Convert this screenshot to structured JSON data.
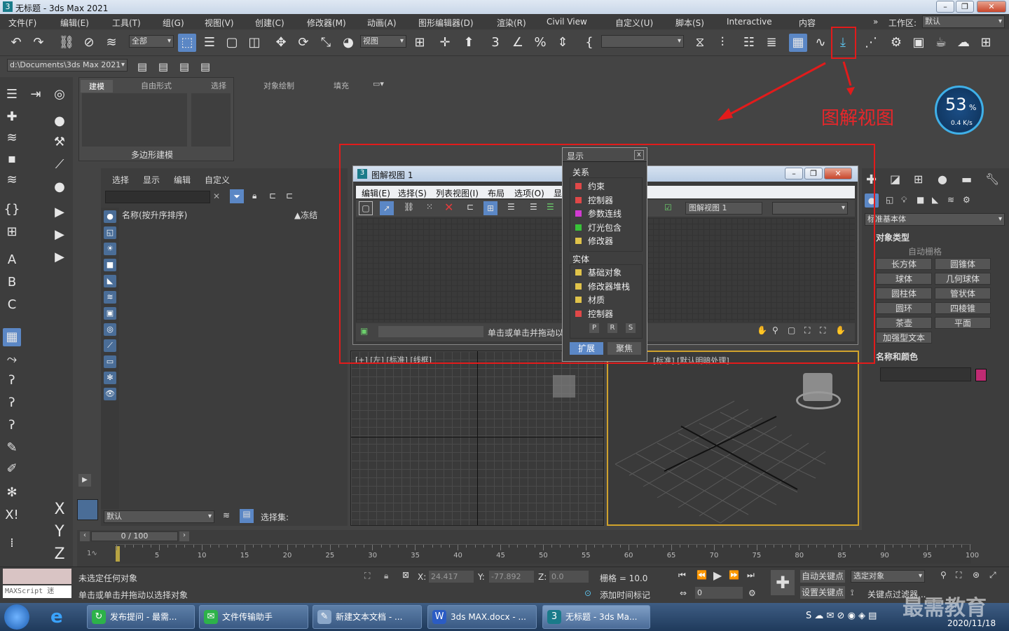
{
  "title_bar": {
    "icon": "3",
    "title": "无标题 - 3ds Max 2021"
  },
  "menu": [
    "文件(F)",
    "编辑(E)",
    "工具(T)",
    "组(G)",
    "视图(V)",
    "创建(C)",
    "修改器(M)",
    "动画(A)",
    "图形编辑器(D)",
    "渲染(R)",
    "Civil View",
    "自定义(U)",
    "脚本(S)",
    "Interactive",
    "内容"
  ],
  "workspace": {
    "label": "工作区:",
    "value": "默认"
  },
  "toolbar": {
    "selection_filter": "全部",
    "ref_coord": "视图"
  },
  "path_dropdown": "d:\\Documents\\3ds Max 2021",
  "ribbon": {
    "tabs": [
      "建模",
      "自由形式",
      "选择",
      "对象绘制",
      "填充"
    ],
    "footer": "多边形建模"
  },
  "scene_explorer": {
    "menu": [
      "选择",
      "显示",
      "编辑",
      "自定义"
    ],
    "column_name": "名称(按升序排序)",
    "column_frozen": "▲冻结",
    "layer_dropdown": "默认",
    "selection_set_label": "选择集:"
  },
  "schematic_view": {
    "title": "图解视图 1",
    "menu": [
      "编辑(E)",
      "选择(S)",
      "列表视图(I)",
      "布局",
      "选项(O)",
      "显"
    ],
    "name_field": "图解视图 1",
    "status_text": "单击或单击并拖动以"
  },
  "display_panel": {
    "title": "显示",
    "close": "x",
    "section_relations": "关系",
    "relations": [
      {
        "label": "约束",
        "color": "#e04848"
      },
      {
        "label": "控制器",
        "color": "#e04848"
      },
      {
        "label": "参数连线",
        "color": "#d23bd2"
      },
      {
        "label": "灯光包含",
        "color": "#38c238"
      },
      {
        "label": "修改器",
        "color": "#e0c34a"
      }
    ],
    "section_entities": "实体",
    "entities": [
      {
        "label": "基础对象",
        "color": "#e0c34a"
      },
      {
        "label": "修改器堆栈",
        "color": "#e0c34a"
      },
      {
        "label": "材质",
        "color": "#e0c34a"
      },
      {
        "label": "控制器",
        "color": "#e04848"
      }
    ],
    "prs": [
      "P",
      "R",
      "S"
    ],
    "expand_button": "扩展",
    "focus_button": "聚焦"
  },
  "viewports": {
    "left_label": "[+] [左] [标准] [线框]",
    "persp_label": "[标准] [默认明暗处理]"
  },
  "command_panel": {
    "category": "标准基本体",
    "object_type_header": "对象类型",
    "auto_grid": "自动栅格",
    "buttons": [
      "长方体",
      "圆锥体",
      "球体",
      "几何球体",
      "圆柱体",
      "管状体",
      "圆环",
      "四棱锥",
      "茶壶",
      "平面"
    ],
    "enhanced_text": "加强型文本",
    "name_color_header": "名称和颜色",
    "color": "#c02b73"
  },
  "annotation": {
    "text": "图解视图",
    "color": "#e8262a"
  },
  "network_meter": {
    "percent": "53",
    "unit": "%",
    "speed": "0.4 K/s"
  },
  "timeline": {
    "frame_counter": "0 / 100",
    "ticks": [
      "5",
      "10",
      "15",
      "20",
      "25",
      "30",
      "35",
      "40",
      "45",
      "50",
      "55",
      "60",
      "65",
      "70",
      "75",
      "80",
      "85",
      "90",
      "95",
      "100"
    ]
  },
  "status": {
    "line1": "未选定任何对象",
    "line2": "单击或单击并拖动以选择对象",
    "maxscript": "MAXScript 迷",
    "x_label": "X:",
    "x_value": "24.417",
    "y_label": "Y:",
    "y_value": "-77.892",
    "z_label": "Z:",
    "z_value": "0.0",
    "grid": "栅格 = 10.0",
    "add_time_tag": "添加时间标记",
    "auto_key": "自动关键点",
    "selected_object": "选定对象",
    "set_key": "设置关键点",
    "key_filter": "关键点过滤器...",
    "frame": "0"
  },
  "taskbar": {
    "items": [
      "发布提问 - 最需...",
      "文件传输助手",
      "新建文本文档 - ...",
      "3ds MAX.docx - ...",
      "无标题 - 3ds Ma..."
    ],
    "date": "2020/11/18",
    "watermark": "最需教育"
  }
}
